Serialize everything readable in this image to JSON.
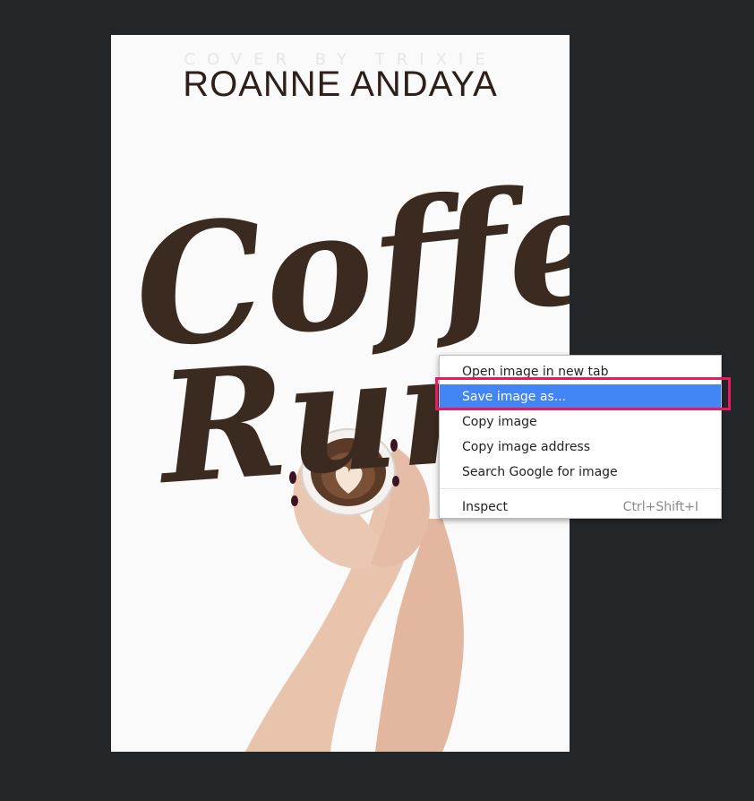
{
  "cover": {
    "credit": "COVER BY TRIXIE",
    "author": "ROANNE ANDAYA",
    "title_line1": "Coffee",
    "title_line2": "Runs",
    "title_color": "#3b2a1f",
    "image": "woman-hands-holding-latte-cup"
  },
  "context_menu": {
    "items": [
      {
        "label": "Open image in new tab"
      },
      {
        "label": "Save image as..."
      },
      {
        "label": "Copy image"
      },
      {
        "label": "Copy image address"
      },
      {
        "label": "Search Google for image"
      },
      {
        "label": "Inspect",
        "shortcut": "Ctrl+Shift+I"
      }
    ],
    "active_color": "#4285f4"
  },
  "highlight": {
    "color": "#e8195d",
    "target": "Save image as..."
  }
}
